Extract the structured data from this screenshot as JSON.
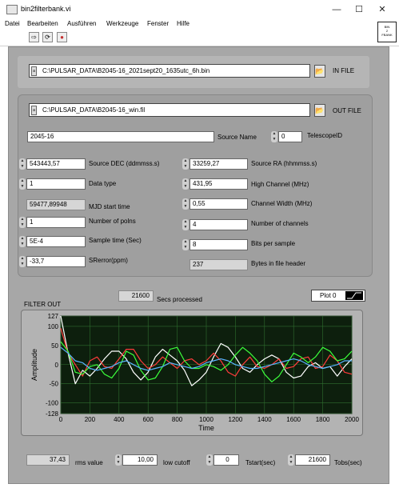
{
  "window": {
    "title": "bin2filterbank.vi",
    "minimize": "—",
    "maximize": "☐",
    "close": "✕"
  },
  "menu": [
    "Datei",
    "Bearbeiten",
    "Ausführen",
    "Werkzeuge",
    "Fenster",
    "Hilfe"
  ],
  "toolbar": {
    "run_arrow": "⇨",
    "run_continuous": "⟳",
    "abort": "●",
    "vi_icon_lines": [
      "BIN",
      "2",
      "FBANK"
    ]
  },
  "infile": {
    "label": "IN FILE",
    "path": "C:\\PULSAR_DATA\\B2045-16_2021sept20_1635utc_6h.bin",
    "path_icon": "a"
  },
  "outfile": {
    "label": "OUT FILE",
    "path": "C:\\PULSAR_DATA\\B2045-16_win.fil",
    "path_icon": "a"
  },
  "source_name": {
    "value": "2045-16",
    "label": "Source Name"
  },
  "telescope_id": {
    "value": "0",
    "label": "TelescopeID"
  },
  "left_fields": [
    {
      "value": "543443,57",
      "label": "Source DEC (ddmmss.s)"
    },
    {
      "value": "1",
      "label": "Data type"
    },
    {
      "value": "59477,89948",
      "label": "MJD start time"
    },
    {
      "value": "1",
      "label": "Number of polns"
    },
    {
      "value": "5E-4",
      "label": "Sample time (Sec)"
    },
    {
      "value": "-33,7",
      "label": "SRerror(ppm)"
    }
  ],
  "right_fields": [
    {
      "value": "33259,27",
      "label": "Source RA (hhmmss.s)"
    },
    {
      "value": "431,95",
      "label": "High Channel (MHz)"
    },
    {
      "value": "0,55",
      "label": "Channel Width (MHz)"
    },
    {
      "value": "4",
      "label": "Number of channels"
    },
    {
      "value": "8",
      "label": "Bits per sample"
    },
    {
      "value": "237",
      "label": "Bytes in file header"
    }
  ],
  "secs_processed": {
    "value": "21600",
    "label": "Secs processed"
  },
  "filter_out": {
    "label": "FILTER OUT",
    "plot_legend": "Plot 0"
  },
  "bottom": {
    "rms": {
      "value": "37,43",
      "label": "rms value"
    },
    "low_cutoff": {
      "value": "10,00",
      "label": "low cutoff"
    },
    "tstart": {
      "value": "0",
      "label": "Tstart(sec)"
    },
    "tobs": {
      "value": "21600",
      "label": "Tobs(sec)"
    }
  },
  "colors": {
    "plot_bg": "#0d1f0d",
    "grid": "#2f6f2f",
    "series": [
      "#ffffff",
      "#ff3b3b",
      "#3cff3c",
      "#5ab4ff"
    ]
  },
  "chart_data": {
    "type": "line",
    "xlabel": "Time",
    "ylabel": "Amplitude",
    "xlim": [
      0,
      2000
    ],
    "ylim": [
      -128,
      127
    ],
    "xticks": [
      "0",
      "200",
      "400",
      "600",
      "800",
      "1000",
      "1200",
      "1400",
      "1600",
      "1800",
      "2000"
    ],
    "yticks": [
      "127",
      "100",
      "50",
      "0",
      "-50",
      "-100",
      "-128"
    ],
    "grid": true,
    "x": [
      0,
      50,
      100,
      150,
      200,
      250,
      300,
      350,
      400,
      450,
      500,
      550,
      600,
      650,
      700,
      750,
      800,
      850,
      900,
      950,
      1000,
      1050,
      1100,
      1150,
      1200,
      1250,
      1300,
      1350,
      1400,
      1450,
      1500,
      1550,
      1600,
      1650,
      1700,
      1750,
      1800,
      1850,
      1900,
      1950,
      2000
    ],
    "series": [
      {
        "values": [
          127,
          30,
          -50,
          -15,
          -30,
          -10,
          15,
          35,
          35,
          15,
          -20,
          -40,
          -20,
          20,
          40,
          25,
          10,
          -15,
          -55,
          -40,
          -20,
          20,
          55,
          45,
          20,
          -10,
          -20,
          0,
          15,
          25,
          15,
          -20,
          -35,
          -30,
          -5,
          5,
          -10,
          -5,
          -30,
          -5,
          15
        ]
      },
      {
        "values": [
          95,
          30,
          0,
          -30,
          10,
          20,
          -5,
          -10,
          15,
          40,
          40,
          10,
          -10,
          0,
          20,
          5,
          -10,
          10,
          15,
          0,
          10,
          30,
          10,
          -20,
          -30,
          0,
          20,
          -5,
          -10,
          0,
          15,
          -10,
          -5,
          15,
          20,
          -10,
          -5,
          25,
          10,
          -20,
          -25
        ]
      },
      {
        "values": [
          60,
          35,
          -20,
          -25,
          -5,
          0,
          -25,
          -35,
          -10,
          35,
          25,
          -15,
          -40,
          -35,
          -5,
          40,
          45,
          10,
          -10,
          -10,
          0,
          -5,
          -15,
          0,
          25,
          45,
          30,
          10,
          -25,
          -45,
          -30,
          0,
          30,
          20,
          5,
          20,
          45,
          35,
          10,
          15,
          35
        ]
      },
      {
        "values": [
          45,
          30,
          10,
          5,
          -10,
          -15,
          -10,
          -5,
          5,
          10,
          0,
          -10,
          -15,
          -10,
          -5,
          5,
          0,
          -5,
          -10,
          -5,
          5,
          10,
          15,
          10,
          0,
          -5,
          -10,
          -10,
          -5,
          0,
          5,
          10,
          15,
          10,
          0,
          -5,
          -10,
          -5,
          0,
          10,
          10
        ]
      }
    ]
  }
}
